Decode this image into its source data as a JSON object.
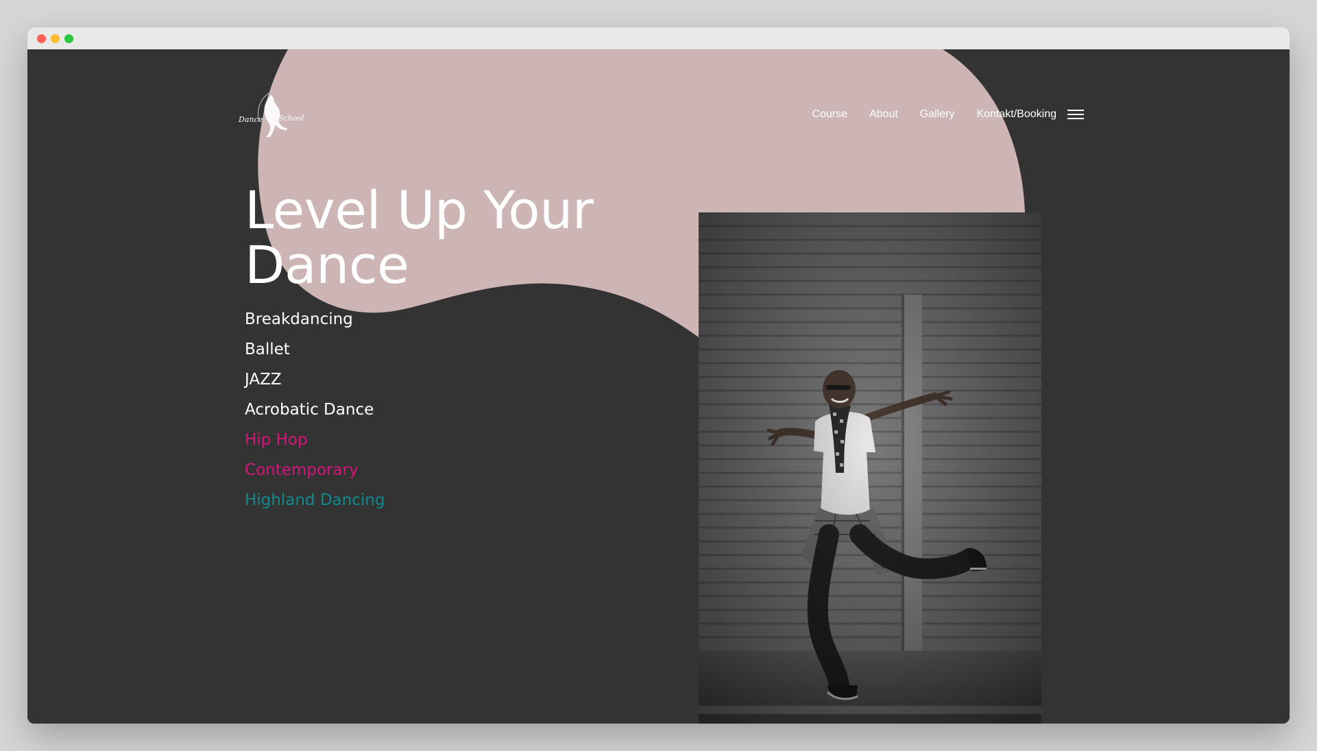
{
  "site": {
    "logo_text_left": "Dance",
    "logo_text_right": "School"
  },
  "nav": {
    "items": [
      {
        "label": "Course"
      },
      {
        "label": "About"
      },
      {
        "label": "Gallery"
      },
      {
        "label": "Kontakt/Booking"
      }
    ],
    "menu_icon": "hamburger-menu-icon"
  },
  "hero": {
    "title": "Level Up Your Dance",
    "styles": [
      {
        "label": "Breakdancing",
        "color": "#ffffff"
      },
      {
        "label": "Ballet",
        "color": "#ffffff"
      },
      {
        "label": "JAZZ",
        "color": "#ffffff"
      },
      {
        "label": "Acrobatic Dance",
        "color": "#ffffff"
      },
      {
        "label": "Hip Hop",
        "color": "#d6147a"
      },
      {
        "label": "Contemporary",
        "color": "#d6147a"
      },
      {
        "label": "Highland Dancing",
        "color": "#108a8f"
      }
    ]
  },
  "colors": {
    "background": "#333333",
    "blob": "#cdb4b5",
    "text": "#ffffff",
    "accent_pink": "#d6147a",
    "accent_teal": "#108a8f"
  },
  "window": {
    "controls": [
      "close",
      "minimize",
      "maximize"
    ],
    "control_colors": [
      "#ff5f57",
      "#febc2e",
      "#28c840"
    ]
  }
}
